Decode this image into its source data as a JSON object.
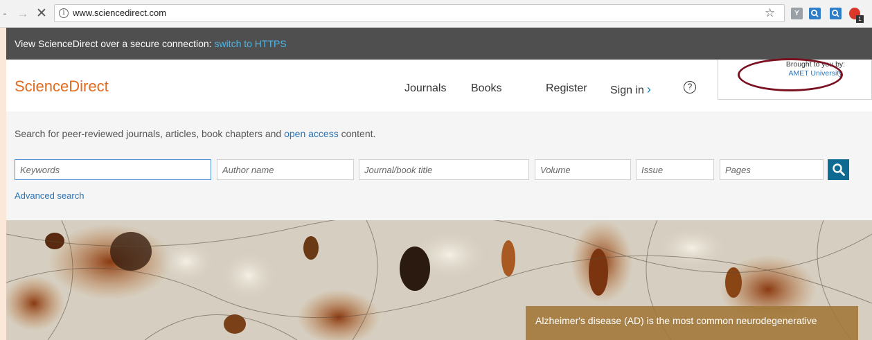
{
  "browser": {
    "url": "www.sciencedirect.com",
    "back_glyph": "-",
    "forward_glyph": "→",
    "stop_glyph": "✕",
    "info_glyph": "i",
    "star_glyph": "☆",
    "extension_badge": "1"
  },
  "banner": {
    "text": "View ScienceDirect over a secure connection: ",
    "link": "switch to HTTPS"
  },
  "header": {
    "logo": "ScienceDirect",
    "nav": {
      "journals": "Journals",
      "books": "Books",
      "register": "Register",
      "sign_in": "Sign in",
      "sign_in_chevron": "›",
      "help": "?"
    },
    "brought_to_you": {
      "label": "Brought to you by:",
      "institution": "AMET University"
    }
  },
  "search": {
    "intro_before": "Search for peer-reviewed journals, articles, book chapters and ",
    "intro_link": "open access",
    "intro_after": " content.",
    "fields": {
      "keywords": "Keywords",
      "author": "Author name",
      "journal": "Journal/book title",
      "volume": "Volume",
      "issue": "Issue",
      "pages": "Pages"
    },
    "advanced": "Advanced search"
  },
  "hero": {
    "caption": "Alzheimer's disease (AD) is the most common neurodegenerative"
  },
  "colors": {
    "brand_orange": "#e06a1e",
    "link_blue": "#2a72b3",
    "banner_gray": "#4f4f4f",
    "search_button": "#0f6a92",
    "annotation_ellipse": "#7a1020"
  }
}
